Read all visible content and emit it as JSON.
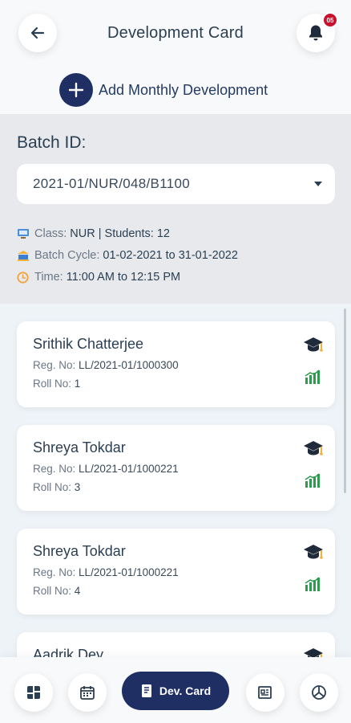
{
  "header": {
    "title": "Development Card",
    "notification_count": "05",
    "add_label": "Add Monthly Development"
  },
  "batch": {
    "title": "Batch ID:",
    "selected": "2021-01/NUR/048/B1100",
    "class_label": "Class:",
    "class_value": "NUR | Students: 12",
    "cycle_label": "Batch Cycle:",
    "cycle_value": "01-02-2021 to 31-01-2022",
    "time_label": "Time:",
    "time_value": "11:00 AM to 12:15 PM"
  },
  "students": [
    {
      "name": "Srithik Chatterjee",
      "reg_label": "Reg. No:",
      "reg": "LL/2021-01/1000300",
      "roll_label": "Roll No:",
      "roll": "1"
    },
    {
      "name": "Shreya Tokdar",
      "reg_label": "Reg. No:",
      "reg": "LL/2021-01/1000221",
      "roll_label": "Roll No:",
      "roll": "3"
    },
    {
      "name": "Shreya Tokdar",
      "reg_label": "Reg. No:",
      "reg": "LL/2021-01/1000221",
      "roll_label": "Roll No:",
      "roll": "4"
    },
    {
      "name": "Aadrik Dey",
      "reg_label": "",
      "reg": "",
      "roll_label": "",
      "roll": ""
    }
  ],
  "nav": {
    "active_label": "Dev. Card"
  },
  "colors": {
    "brand": "#1f2f63",
    "badge": "#c8102e",
    "chart_icon": "#2e9b4e"
  }
}
